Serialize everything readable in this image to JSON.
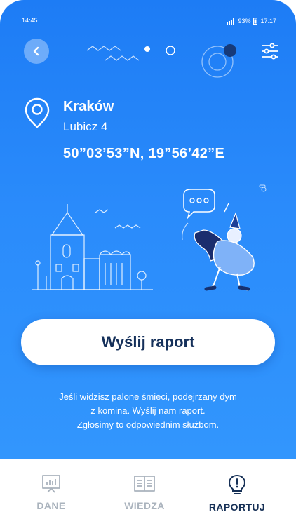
{
  "status_bar": {
    "time": "14:45",
    "battery": "93%",
    "clock": "17:17"
  },
  "header": {
    "back_icon": "chevron-left-icon",
    "filter_icon": "sliders-icon"
  },
  "location": {
    "city": "Kraków",
    "street": "Lubicz 4",
    "coordinates": "50”03’53”N, 19”56’42”E"
  },
  "action": {
    "send_label": "Wyślij raport"
  },
  "description": {
    "line1": "Jeśli widzisz palone śmieci, podejrzany dym",
    "line2": "z komina. Wyślij nam raport.",
    "line3": "Zgłosimy to odpowiednim służbom."
  },
  "nav": {
    "items": [
      {
        "label": "DANE",
        "icon": "chart-board-icon",
        "active": false
      },
      {
        "label": "WIEDZA",
        "icon": "book-icon",
        "active": false
      },
      {
        "label": "RAPORTUJ",
        "icon": "alert-bulb-icon",
        "active": true
      }
    ]
  },
  "colors": {
    "primary": "#1d7cf5",
    "dark_text": "#15305a",
    "inactive": "#aab3bd"
  }
}
